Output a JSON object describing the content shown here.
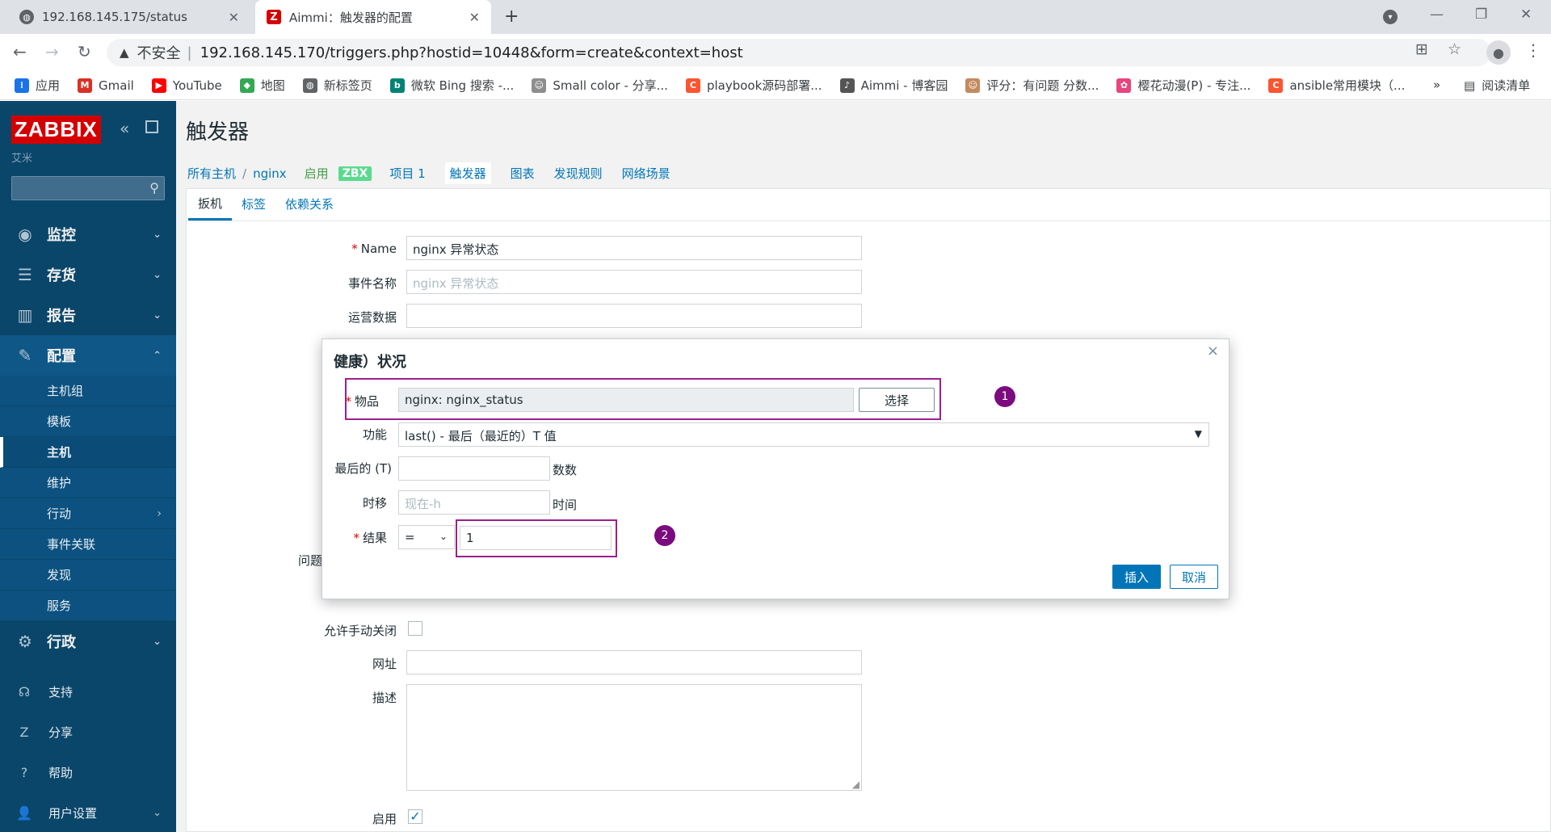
{
  "browser": {
    "tabs": [
      {
        "title": "192.168.145.175/status"
      },
      {
        "title": "Aimmi：触发器的配置"
      }
    ],
    "new_tab": "+",
    "address": {
      "insecure_label": "不安全",
      "separator": "|",
      "url": "192.168.145.170/triggers.php?hostid=10448&form=create&context=host"
    },
    "bookmarks": [
      {
        "label": "应用",
        "icon": "apps-icon",
        "color": "#1a73e8"
      },
      {
        "label": "Gmail",
        "icon": "gmail-icon",
        "color": "#d93025"
      },
      {
        "label": "YouTube",
        "icon": "youtube-icon",
        "color": "#ff0000"
      },
      {
        "label": "地图",
        "icon": "maps-icon",
        "color": "#34a853"
      },
      {
        "label": "新标签页",
        "icon": "globe-icon",
        "color": "#5f6368"
      },
      {
        "label": "微软 Bing 搜索 -...",
        "icon": "bing-icon",
        "color": "#008373"
      },
      {
        "label": "Small color - 分享...",
        "icon": "avatar-icon",
        "color": "#8e8e8e"
      },
      {
        "label": "playbook源码部署...",
        "icon": "csdn-icon",
        "color": "#fc5531"
      },
      {
        "label": "Aimmi - 博客园",
        "icon": "cnblogs-icon",
        "color": "#555555"
      },
      {
        "label": "评分：有问题 分数...",
        "icon": "avatar-icon",
        "color": "#c48a5f"
      },
      {
        "label": "樱花动漫(P) - 专注...",
        "icon": "flower-icon",
        "color": "#e8457c"
      },
      {
        "label": "ansible常用模块（...",
        "icon": "csdn-icon",
        "color": "#fc5531"
      }
    ],
    "bookmarks_more": "»",
    "reading_list": "阅读清单"
  },
  "sidebar": {
    "logo": "ZABBIX",
    "server_name": "艾米",
    "menu": [
      {
        "label": "监控",
        "icon": "eye-icon"
      },
      {
        "label": "存货",
        "icon": "list-icon"
      },
      {
        "label": "报告",
        "icon": "chart-icon"
      },
      {
        "label": "配置",
        "icon": "wrench-icon"
      }
    ],
    "config_submenu": [
      {
        "label": "主机组"
      },
      {
        "label": "模板"
      },
      {
        "label": "主机"
      },
      {
        "label": "维护"
      },
      {
        "label": "行动"
      },
      {
        "label": "事件关联"
      },
      {
        "label": "发现"
      },
      {
        "label": "服务"
      }
    ],
    "admin": {
      "label": "行政",
      "icon": "gear-icon"
    },
    "bottom": [
      {
        "label": "支持",
        "icon": "headset-icon"
      },
      {
        "label": "分享",
        "icon": "share-icon"
      },
      {
        "label": "帮助",
        "icon": "help-icon"
      },
      {
        "label": "用户设置",
        "icon": "user-icon"
      }
    ]
  },
  "page": {
    "title": "触发器",
    "breadcrumb": {
      "all_hosts": "所有主机",
      "separator": "/",
      "host": "nginx",
      "status": "启用",
      "zbx_badge": "ZBX",
      "items": "项目 1",
      "triggers": "触发器",
      "graphs": "图表",
      "discovery": "发现规则",
      "web": "网络场景"
    },
    "tabs": [
      "扳机",
      "标签",
      "依赖关系"
    ],
    "form": {
      "name_label": "Name",
      "name_value": "nginx 异常状态",
      "event_name_label": "事件名称",
      "event_name_placeholder": "nginx 异常状态",
      "opdata_label": "运营数据",
      "problem_label": "问题",
      "manual_close_label": "允许手动关闭",
      "url_label": "网址",
      "description_label": "描述",
      "enabled_label": "启用",
      "enabled_checked": true
    }
  },
  "dialog": {
    "title": "健康）状况",
    "close": "×",
    "item_label": "物品",
    "item_value": "nginx: nginx_status",
    "select_button": "选择",
    "function_label": "功能",
    "function_value": "last() - 最后（最近的）T 值",
    "last_t_label": "最后的 (T)",
    "last_t_value": "",
    "last_t_unit": "数数",
    "shift_label": "时移",
    "shift_placeholder": "现在-h",
    "shift_unit": "时间",
    "result_label": "结果",
    "result_operator": "=",
    "result_value": "1",
    "insert_button": "插入",
    "cancel_button": "取消",
    "markers": [
      "1",
      "2"
    ],
    "highlight_color": "#9c1f8f"
  }
}
